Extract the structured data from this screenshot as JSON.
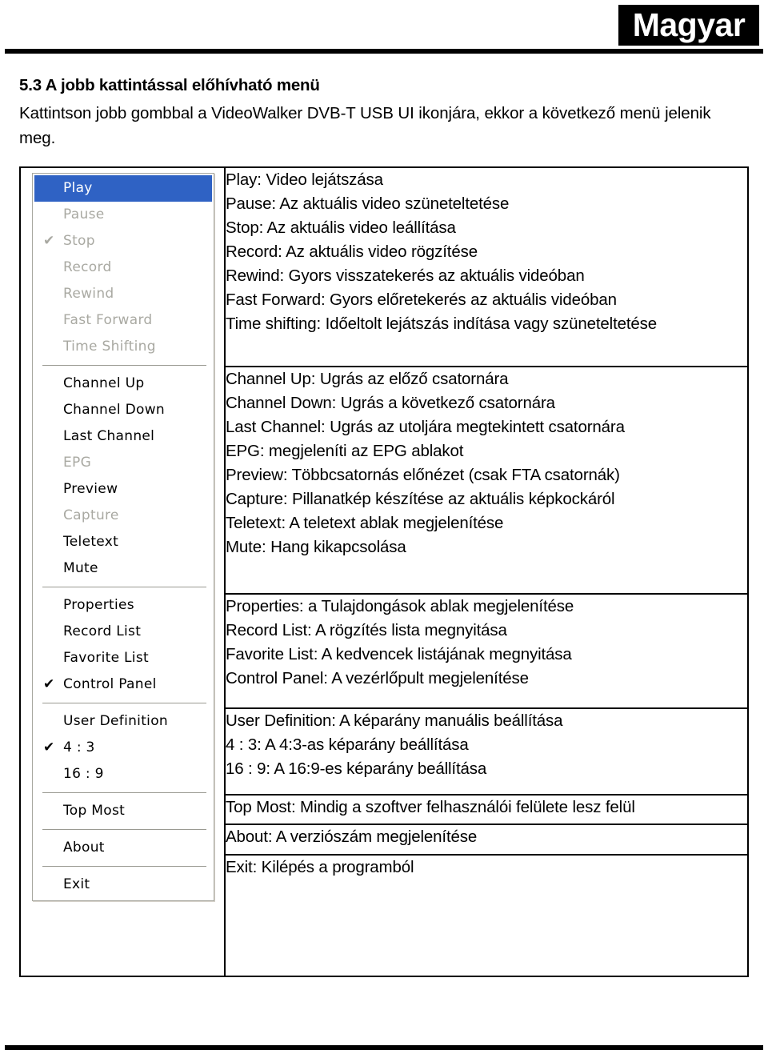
{
  "header": {
    "language_badge": "Magyar"
  },
  "section": {
    "heading": "5.3 A jobb kattintással előhívható menü",
    "intro": "Kattintson jobb gombbal a VideoWalker DVB-T USB UI ikonjára, ekkor a következő menü jelenik meg."
  },
  "context_menu": {
    "groups": [
      {
        "items": [
          {
            "label": "Play",
            "state": "selected",
            "checked": false
          },
          {
            "label": "Pause",
            "state": "disabled",
            "checked": false
          },
          {
            "label": "Stop",
            "state": "disabled",
            "checked": true
          },
          {
            "label": "Record",
            "state": "disabled",
            "checked": false
          },
          {
            "label": "Rewind",
            "state": "disabled",
            "checked": false
          },
          {
            "label": "Fast Forward",
            "state": "disabled",
            "checked": false
          },
          {
            "label": "Time Shifting",
            "state": "disabled",
            "checked": false
          }
        ]
      },
      {
        "items": [
          {
            "label": "Channel Up",
            "state": "enabled",
            "checked": false
          },
          {
            "label": "Channel Down",
            "state": "enabled",
            "checked": false
          },
          {
            "label": "Last Channel",
            "state": "enabled",
            "checked": false
          },
          {
            "label": "EPG",
            "state": "disabled",
            "checked": false
          },
          {
            "label": "Preview",
            "state": "enabled",
            "checked": false
          },
          {
            "label": "Capture",
            "state": "disabled",
            "checked": false
          },
          {
            "label": "Teletext",
            "state": "enabled",
            "checked": false
          },
          {
            "label": "Mute",
            "state": "enabled",
            "checked": false
          }
        ]
      },
      {
        "items": [
          {
            "label": "Properties",
            "state": "enabled",
            "checked": false
          },
          {
            "label": "Record List",
            "state": "enabled",
            "checked": false
          },
          {
            "label": "Favorite List",
            "state": "enabled",
            "checked": false
          },
          {
            "label": "Control Panel",
            "state": "enabled",
            "checked": true
          }
        ]
      },
      {
        "items": [
          {
            "label": "User Definition",
            "state": "enabled",
            "checked": false
          },
          {
            "label": "4 : 3",
            "state": "enabled",
            "checked": true
          },
          {
            "label": "16 : 9",
            "state": "enabled",
            "checked": false
          }
        ]
      },
      {
        "items": [
          {
            "label": "Top Most",
            "state": "enabled",
            "checked": false
          }
        ]
      },
      {
        "items": [
          {
            "label": "About",
            "state": "enabled",
            "checked": false
          }
        ]
      },
      {
        "items": [
          {
            "label": "Exit",
            "state": "enabled",
            "checked": false
          }
        ]
      }
    ],
    "check_glyph": "✔",
    "colors": {
      "selection_blue": "#2f62c4",
      "disabled_grey": "#a9a9a2",
      "separator_grey": "#9a9a92"
    }
  },
  "descriptions": {
    "blocks": [
      {
        "lines": [
          "Play: Video lejátszása",
          "Pause: Az aktuális video szüneteltetése",
          "Stop: Az aktuális video leállítása",
          "Record: Az aktuális video rögzítése",
          "Rewind: Gyors visszatekerés az aktuális videóban",
          "Fast Forward: Gyors előretekerés az aktuális videóban",
          "Time shifting: Időeltolt lejátszás indítása vagy szüneteltetése"
        ]
      },
      {
        "lines": [
          "Channel Up: Ugrás az előző csatornára",
          "Channel Down: Ugrás a következő csatornára",
          "Last Channel: Ugrás az utoljára megtekintett csatornára",
          "EPG: megjeleníti az EPG ablakot",
          "Preview: Többcsatornás előnézet (csak FTA csatornák)",
          "Capture: Pillanatkép készítése az aktuális képkockáról",
          "Teletext: A teletext ablak megjelenítése",
          "Mute: Hang kikapcsolása"
        ]
      },
      {
        "lines": [
          "Properties: a Tulajdongások ablak megjelenítése",
          "Record List: A rögzítés lista megnyitása",
          "Favorite List: A kedvencek listájának megnyitása",
          "Control Panel: A vezérlőpult megjelenítése"
        ]
      },
      {
        "lines": [
          "User Definition: A képarány manuális beállítása",
          "4 : 3: A 4:3-as képarány beállítása",
          "16 : 9: A 16:9-es képarány beállítása"
        ]
      },
      {
        "lines": [
          "Top Most: Mindig a szoftver felhasználói felülete lesz felül"
        ]
      },
      {
        "lines": [
          "About: A verziószám megjelenítése"
        ]
      },
      {
        "lines": [
          "Exit: Kilépés a programból"
        ]
      }
    ]
  }
}
